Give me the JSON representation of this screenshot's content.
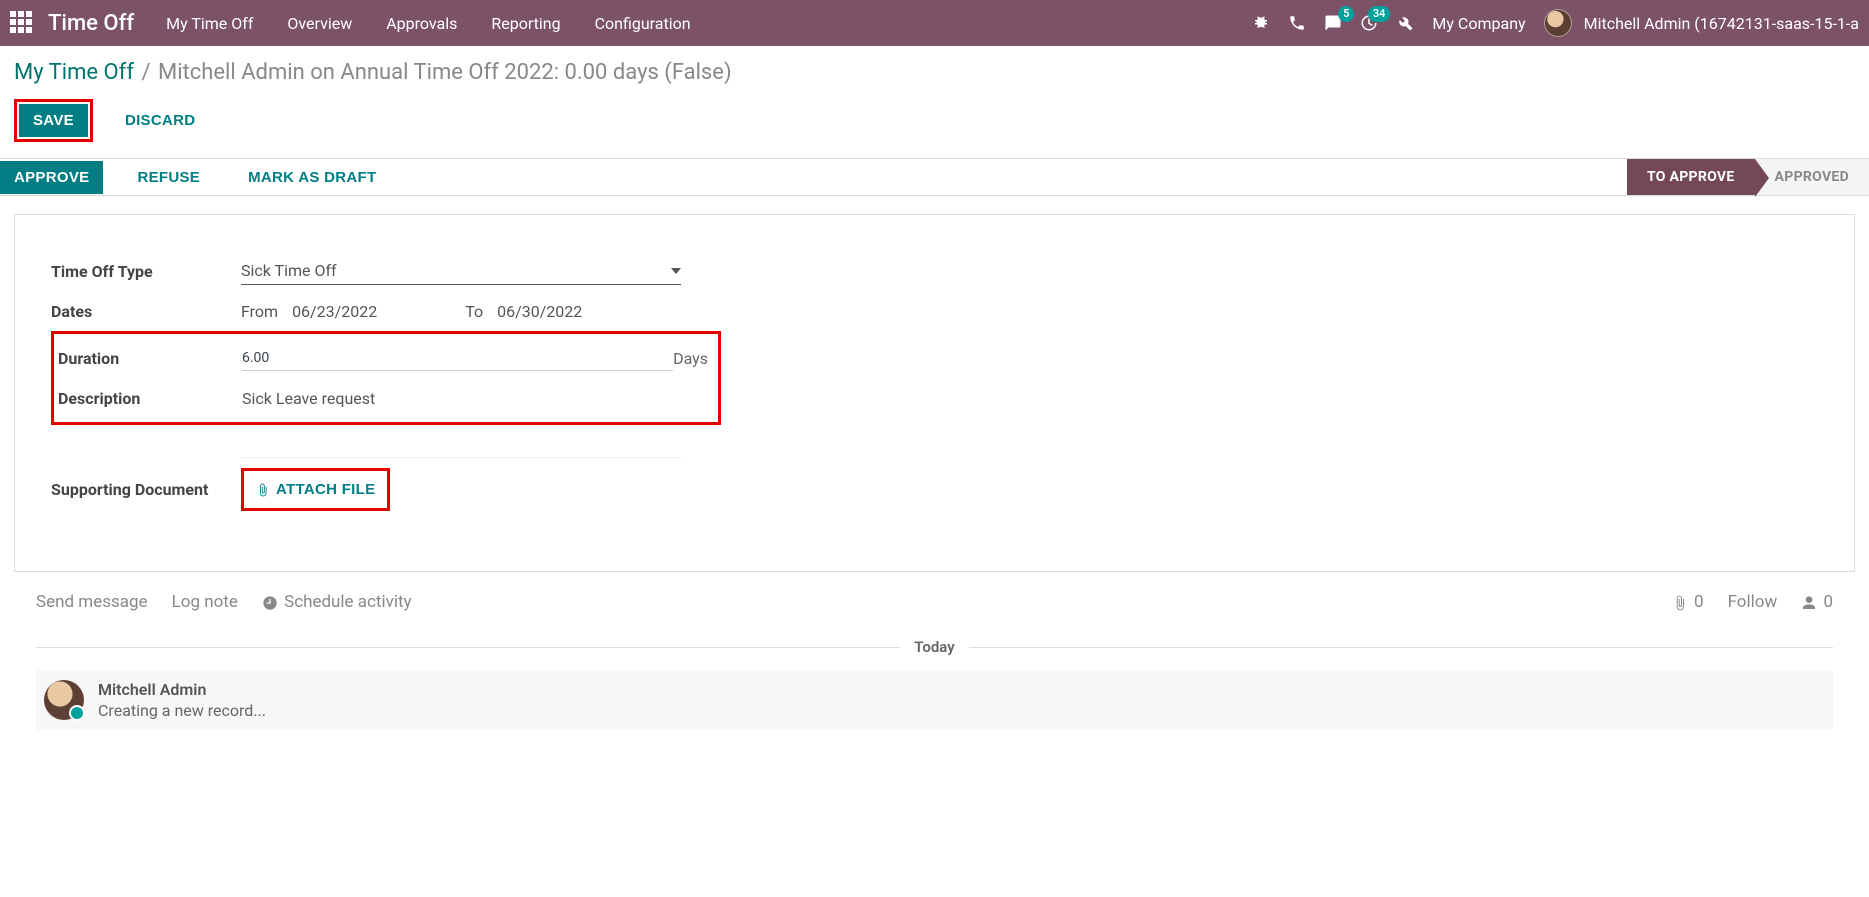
{
  "nav": {
    "brand": "Time Off",
    "links": [
      "My Time Off",
      "Overview",
      "Approvals",
      "Reporting",
      "Configuration"
    ],
    "badges": {
      "messages": "5",
      "activities": "34"
    },
    "company": "My Company",
    "user": "Mitchell Admin (16742131-saas-15-1-a"
  },
  "breadcrumb": {
    "root": "My Time Off",
    "current": "Mitchell Admin on Annual Time Off 2022: 0.00 days (False)"
  },
  "buttons": {
    "save": "SAVE",
    "discard": "DISCARD",
    "approve": "APPROVE",
    "refuse": "REFUSE",
    "mark_draft": "MARK AS DRAFT",
    "attach": "ATTACH FILE"
  },
  "status": {
    "active": "TO APPROVE",
    "next": "APPROVED"
  },
  "form": {
    "labels": {
      "type": "Time Off Type",
      "dates": "Dates",
      "from": "From",
      "to": "To",
      "duration": "Duration",
      "days": "Days",
      "description": "Description",
      "supporting": "Supporting Document"
    },
    "values": {
      "type": "Sick Time Off",
      "date_from": "06/23/2022",
      "date_to": "06/30/2022",
      "duration": "6.00",
      "description": "Sick Leave request"
    }
  },
  "chatter": {
    "send": "Send message",
    "log": "Log note",
    "schedule": "Schedule activity",
    "attach_count": "0",
    "follow": "Follow",
    "follower_count": "0",
    "today": "Today",
    "msg_author": "Mitchell Admin",
    "msg_text": "Creating a new record..."
  }
}
